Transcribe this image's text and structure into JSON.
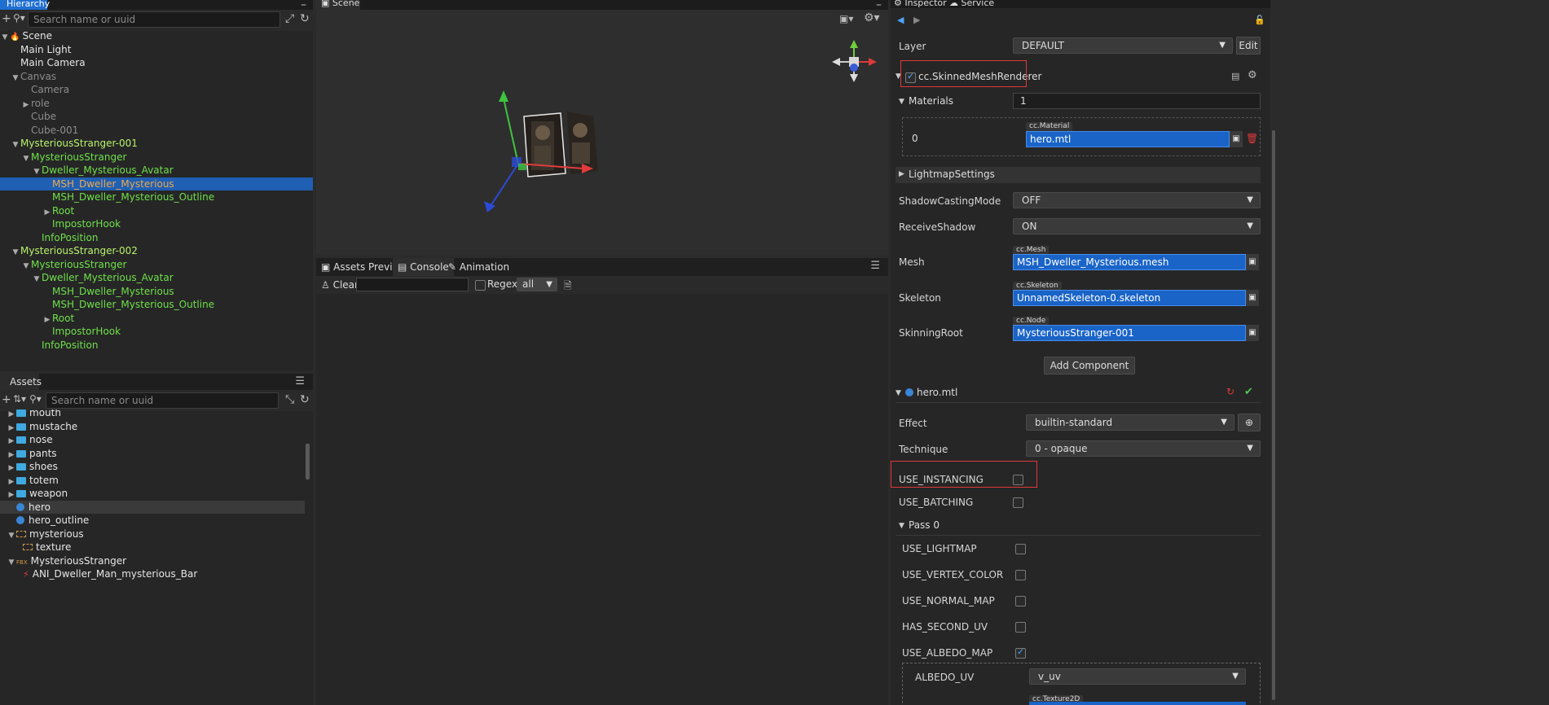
{
  "hierarchy": {
    "tab": "Hierarchy",
    "search_placeholder": "Search name or uuid",
    "nodes": [
      {
        "label": "Scene",
        "indent": 0,
        "tri": "▼",
        "color": "white",
        "icon": "fire-icon"
      },
      {
        "label": "Main Light",
        "indent": 1,
        "tri": "",
        "color": "white"
      },
      {
        "label": "Main Camera",
        "indent": 1,
        "tri": "",
        "color": "white"
      },
      {
        "label": "Canvas",
        "indent": 1,
        "tri": "▼",
        "color": "gray"
      },
      {
        "label": "Camera",
        "indent": 2,
        "tri": "",
        "color": "gray"
      },
      {
        "label": "role",
        "indent": 2,
        "tri": "▶",
        "color": "gray"
      },
      {
        "label": "Cube",
        "indent": 2,
        "tri": "",
        "color": "gray"
      },
      {
        "label": "Cube-001",
        "indent": 2,
        "tri": "",
        "color": "gray"
      },
      {
        "label": "MysteriousStranger-001",
        "indent": 1,
        "tri": "▼",
        "color": "lime"
      },
      {
        "label": "MysteriousStranger",
        "indent": 2,
        "tri": "▼",
        "color": "green"
      },
      {
        "label": "Dweller_Mysterious_Avatar",
        "indent": 3,
        "tri": "▼",
        "color": "green"
      },
      {
        "label": "MSH_Dweller_Mysterious",
        "indent": 4,
        "tri": "",
        "color": "orange",
        "selected": true
      },
      {
        "label": "MSH_Dweller_Mysterious_Outline",
        "indent": 4,
        "tri": "",
        "color": "green"
      },
      {
        "label": "Root",
        "indent": 4,
        "tri": "▶",
        "color": "green"
      },
      {
        "label": "ImpostorHook",
        "indent": 4,
        "tri": "",
        "color": "green"
      },
      {
        "label": "InfoPosition",
        "indent": 3,
        "tri": "",
        "color": "green"
      },
      {
        "label": "MysteriousStranger-002",
        "indent": 1,
        "tri": "▼",
        "color": "lime"
      },
      {
        "label": "MysteriousStranger",
        "indent": 2,
        "tri": "▼",
        "color": "green"
      },
      {
        "label": "Dweller_Mysterious_Avatar",
        "indent": 3,
        "tri": "▼",
        "color": "green"
      },
      {
        "label": "MSH_Dweller_Mysterious",
        "indent": 4,
        "tri": "",
        "color": "green"
      },
      {
        "label": "MSH_Dweller_Mysterious_Outline",
        "indent": 4,
        "tri": "",
        "color": "green"
      },
      {
        "label": "Root",
        "indent": 4,
        "tri": "▶",
        "color": "green"
      },
      {
        "label": "ImpostorHook",
        "indent": 4,
        "tri": "",
        "color": "green"
      },
      {
        "label": "InfoPosition",
        "indent": 3,
        "tri": "",
        "color": "green"
      }
    ]
  },
  "assets": {
    "tab": "Assets",
    "search_placeholder": "Search name or uuid",
    "items": [
      {
        "label": "mouth",
        "indent": 1,
        "tri": "▶",
        "icon": "folder"
      },
      {
        "label": "mustache",
        "indent": 1,
        "tri": "▶",
        "icon": "folder"
      },
      {
        "label": "nose",
        "indent": 1,
        "tri": "▶",
        "icon": "folder"
      },
      {
        "label": "pants",
        "indent": 1,
        "tri": "▶",
        "icon": "folder"
      },
      {
        "label": "shoes",
        "indent": 1,
        "tri": "▶",
        "icon": "folder"
      },
      {
        "label": "totem",
        "indent": 1,
        "tri": "▶",
        "icon": "folder"
      },
      {
        "label": "weapon",
        "indent": 1,
        "tri": "▶",
        "icon": "folder"
      },
      {
        "label": "hero",
        "indent": 1,
        "tri": "",
        "icon": "material",
        "selected": true
      },
      {
        "label": "hero_outline",
        "indent": 1,
        "tri": "",
        "icon": "material"
      },
      {
        "label": "mysterious",
        "indent": 1,
        "tri": "▼",
        "icon": "image"
      },
      {
        "label": "texture",
        "indent": 2,
        "tri": "",
        "icon": "image"
      },
      {
        "label": "MysteriousStranger",
        "indent": 1,
        "tri": "▼",
        "icon": "fbx"
      },
      {
        "label": "ANI_Dweller_Man_mysterious_Bar",
        "indent": 2,
        "tri": "",
        "icon": "anim"
      }
    ],
    "fbx_badge": "FBX"
  },
  "scene": {
    "tab": "Scene"
  },
  "console": {
    "tabs": [
      "Assets Preview",
      "Console",
      "Animation"
    ],
    "clear_label": "Clear",
    "regex_label": "Regex",
    "filter_value": "all"
  },
  "inspector": {
    "tabs": [
      "Inspector",
      "Service"
    ],
    "layer_label": "Layer",
    "layer_value": "DEFAULT",
    "edit_label": "Edit",
    "component_name": "cc.SkinnedMeshRenderer",
    "materials_label": "Materials",
    "materials_count": "1",
    "material_index": "0",
    "material_tag": "cc.Material",
    "material_value": "hero.mtl",
    "lightmap_label": "LightmapSettings",
    "shadow_label": "ShadowCastingMode",
    "shadow_value": "OFF",
    "receive_label": "ReceiveShadow",
    "receive_value": "ON",
    "mesh_label": "Mesh",
    "mesh_tag": "cc.Mesh",
    "mesh_value": "MSH_Dweller_Mysterious.mesh",
    "skeleton_label": "Skeleton",
    "skeleton_tag": "cc.Skeleton",
    "skeleton_value": "UnnamedSkeleton-0.skeleton",
    "skinroot_label": "SkinningRoot",
    "skinroot_tag": "cc.Node",
    "skinroot_value": "MysteriousStranger-001",
    "add_component_label": "Add Component",
    "mtl_section": "hero.mtl",
    "effect_label": "Effect",
    "effect_value": "builtin-standard",
    "technique_label": "Technique",
    "technique_value": "0 - opaque",
    "use_instancing": "USE_INSTANCING",
    "use_batching": "USE_BATCHING",
    "pass0": "Pass 0",
    "use_lightmap": "USE_LIGHTMAP",
    "use_vertex_color": "USE_VERTEX_COLOR",
    "use_normal_map": "USE_NORMAL_MAP",
    "has_second_uv": "HAS_SECOND_UV",
    "use_albedo_map": "USE_ALBEDO_MAP",
    "albedo_uv_label": "ALBEDO_UV",
    "albedo_uv_value": "v_uv",
    "texture_tag": "cc.Texture2D"
  },
  "colors": {
    "selection": "#1f5fb4",
    "asset_field": "#1a64c8",
    "highlight_red": "#e0383b"
  }
}
